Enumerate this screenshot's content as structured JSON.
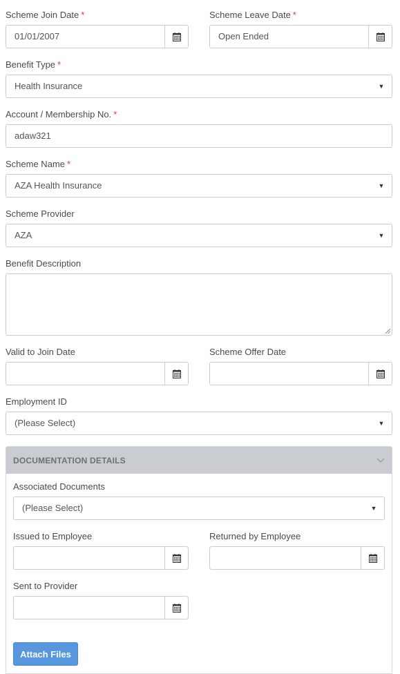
{
  "form": {
    "scheme_join_date": {
      "label": "Scheme Join Date",
      "required": "*",
      "value": "01/01/2007",
      "icon": "calendar-icon"
    },
    "scheme_leave_date": {
      "label": "Scheme Leave Date",
      "required": "*",
      "value": "Open Ended",
      "icon": "calendar-icon"
    },
    "benefit_type": {
      "label": "Benefit Type",
      "required": "*",
      "value": "Health Insurance",
      "icon": "caret-down-icon"
    },
    "account_no": {
      "label": "Account / Membership No.",
      "required": "*",
      "value": "adaw321"
    },
    "scheme_name": {
      "label": "Scheme Name",
      "required": "*",
      "value": "AZA Health Insurance",
      "icon": "caret-down-icon"
    },
    "scheme_provider": {
      "label": "Scheme Provider",
      "value": "AZA",
      "icon": "caret-down-icon"
    },
    "benefit_description": {
      "label": "Benefit Description",
      "value": ""
    },
    "valid_to_join_date": {
      "label": "Valid to Join Date",
      "value": "",
      "icon": "calendar-icon"
    },
    "scheme_offer_date": {
      "label": "Scheme Offer Date",
      "value": "",
      "icon": "calendar-icon"
    },
    "employment_id": {
      "label": "Employment ID",
      "value": "(Please Select)",
      "icon": "caret-down-icon"
    }
  },
  "documentation": {
    "title": "DOCUMENTATION DETAILS",
    "toggle_icon": "chevron-down-icon",
    "associated_documents": {
      "label": "Associated Documents",
      "value": "(Please Select)",
      "icon": "caret-down-icon"
    },
    "issued_to_employee": {
      "label": "Issued to Employee",
      "value": "",
      "icon": "calendar-icon"
    },
    "returned_by_employee": {
      "label": "Returned by Employee",
      "value": "",
      "icon": "calendar-icon"
    },
    "sent_to_provider": {
      "label": "Sent to Provider",
      "value": "",
      "icon": "calendar-icon"
    },
    "attach_button": "Attach Files"
  },
  "colors": {
    "required": "#e0393e",
    "button": "#5697de",
    "panel_header": "#c9cdd1"
  }
}
